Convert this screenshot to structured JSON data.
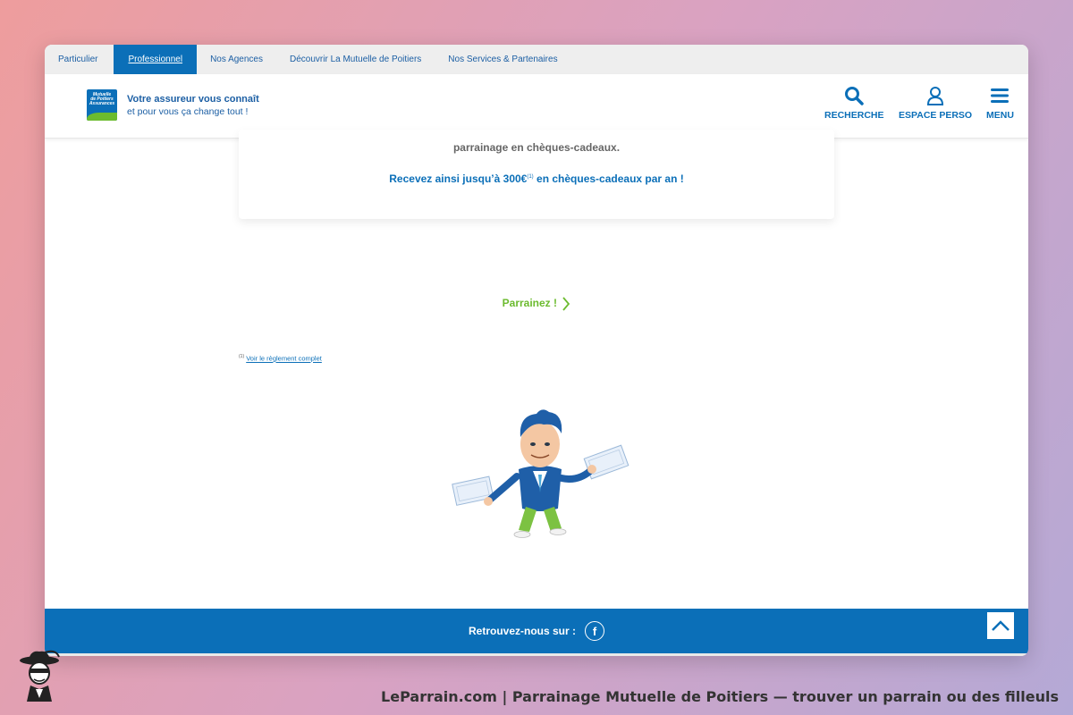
{
  "topnav": {
    "items": [
      {
        "label": "Particulier"
      },
      {
        "label": "Professionnel",
        "active": true
      },
      {
        "label": "Nos Agences"
      },
      {
        "label": "Découvrir La Mutuelle de Poitiers"
      },
      {
        "label": "Nos Services & Partenaires"
      }
    ]
  },
  "header": {
    "logo_lines": [
      "Mutuelle",
      "de Poitiers",
      "Assurances"
    ],
    "tagline_1": "Votre assureur vous connaît",
    "tagline_2": "et pour vous ça change tout !",
    "search_label": "RECHERCHE",
    "account_label": "ESPACE PERSO",
    "menu_label": "MENU"
  },
  "card": {
    "line1": "parrainage en chèques-cadeaux.",
    "line2_before": "Recevez ainsi jusqu’à 300€",
    "line2_sup": "(1)",
    "line2_after": " en chèques-cadeaux par an !"
  },
  "cta": {
    "label": "Parrainez !"
  },
  "footnote": {
    "sup": "(1)",
    "link": "Voir le règlement complet"
  },
  "footer": {
    "label": "Retrouvez-nous sur :",
    "facebook_glyph": "f"
  },
  "caption": "LeParrain.com | Parrainage Mutuelle de Poitiers — trouver un parrain ou des filleuls",
  "colors": {
    "brand_blue": "#0b6fb8",
    "brand_green": "#6cbb2f",
    "text_grey": "#666666"
  }
}
